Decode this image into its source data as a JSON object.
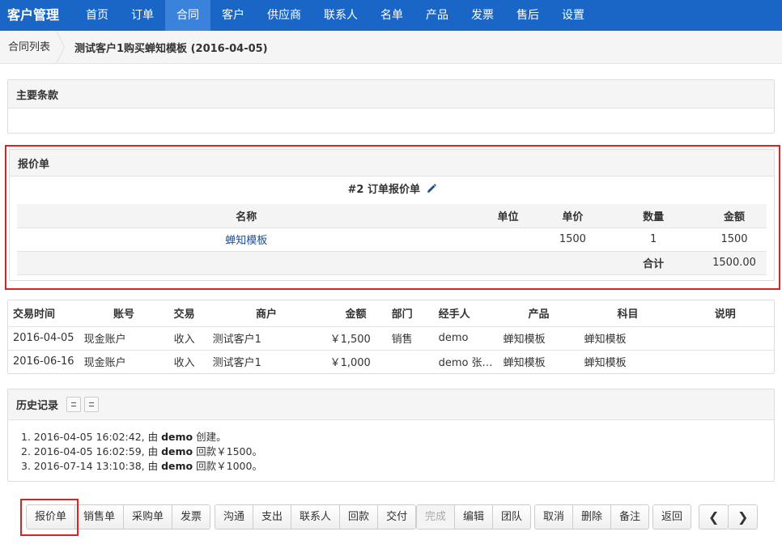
{
  "nav": {
    "brand": "客户管理",
    "items": [
      "首页",
      "订单",
      "合同",
      "客户",
      "供应商",
      "联系人",
      "名单",
      "产品",
      "发票",
      "售后",
      "设置"
    ]
  },
  "breadcrumb": {
    "link": "合同列表",
    "current": "测试客户1购买蝉知模板 (2016-04-05)"
  },
  "main_terms": {
    "title": "主要条款"
  },
  "quote": {
    "title": "报价单",
    "subtitle": "#2 订单报价单",
    "headers": [
      "名称",
      "单位",
      "单价",
      "数量",
      "金额"
    ],
    "rows": [
      [
        "蝉知模板",
        "",
        "1500",
        "1",
        "1500"
      ]
    ],
    "total_label": "合计",
    "total_value": "1500.00"
  },
  "transactions": {
    "headers": [
      "交易时间",
      "账号",
      "交易",
      "商户",
      "金额",
      "部门",
      "经手人",
      "产品",
      "科目",
      "说明"
    ],
    "rows": [
      [
        "2016-04-05",
        "现金账户",
        "收入",
        "测试客户1",
        "￥1,500",
        "销售",
        "demo",
        "蝉知模板",
        "蝉知模板",
        ""
      ],
      [
        "2016-06-16",
        "现金账户",
        "收入",
        "测试客户1",
        "￥1,000",
        "",
        "demo 张…",
        "蝉知模板",
        "蝉知模板",
        ""
      ]
    ]
  },
  "history": {
    "title": "历史记录",
    "entries": [
      {
        "num": "1.",
        "time": "2016-04-05 16:02:42, 由 ",
        "user": "demo",
        "action": " 创建。"
      },
      {
        "num": "2.",
        "time": "2016-04-05 16:02:59, 由 ",
        "user": "demo",
        "action": " 回款￥1500。"
      },
      {
        "num": "3.",
        "time": "2016-07-14 13:10:38, 由 ",
        "user": "demo",
        "action": " 回款￥1000。"
      }
    ]
  },
  "buttons": {
    "group1": [
      "报价单",
      "销售单",
      "采购单",
      "发票"
    ],
    "group2": [
      "沟通",
      "支出",
      "联系人",
      "回款",
      "交付"
    ],
    "group3": [
      "完成",
      "编辑",
      "团队"
    ],
    "group4": [
      "取消",
      "删除",
      "备注"
    ],
    "back": "返回",
    "prev": "❮",
    "next": "❯"
  },
  "colors": {
    "nav": "#1a66c7",
    "nav_active": "#3a82db",
    "highlight": "#e02020",
    "link": "#1a4f8f"
  }
}
